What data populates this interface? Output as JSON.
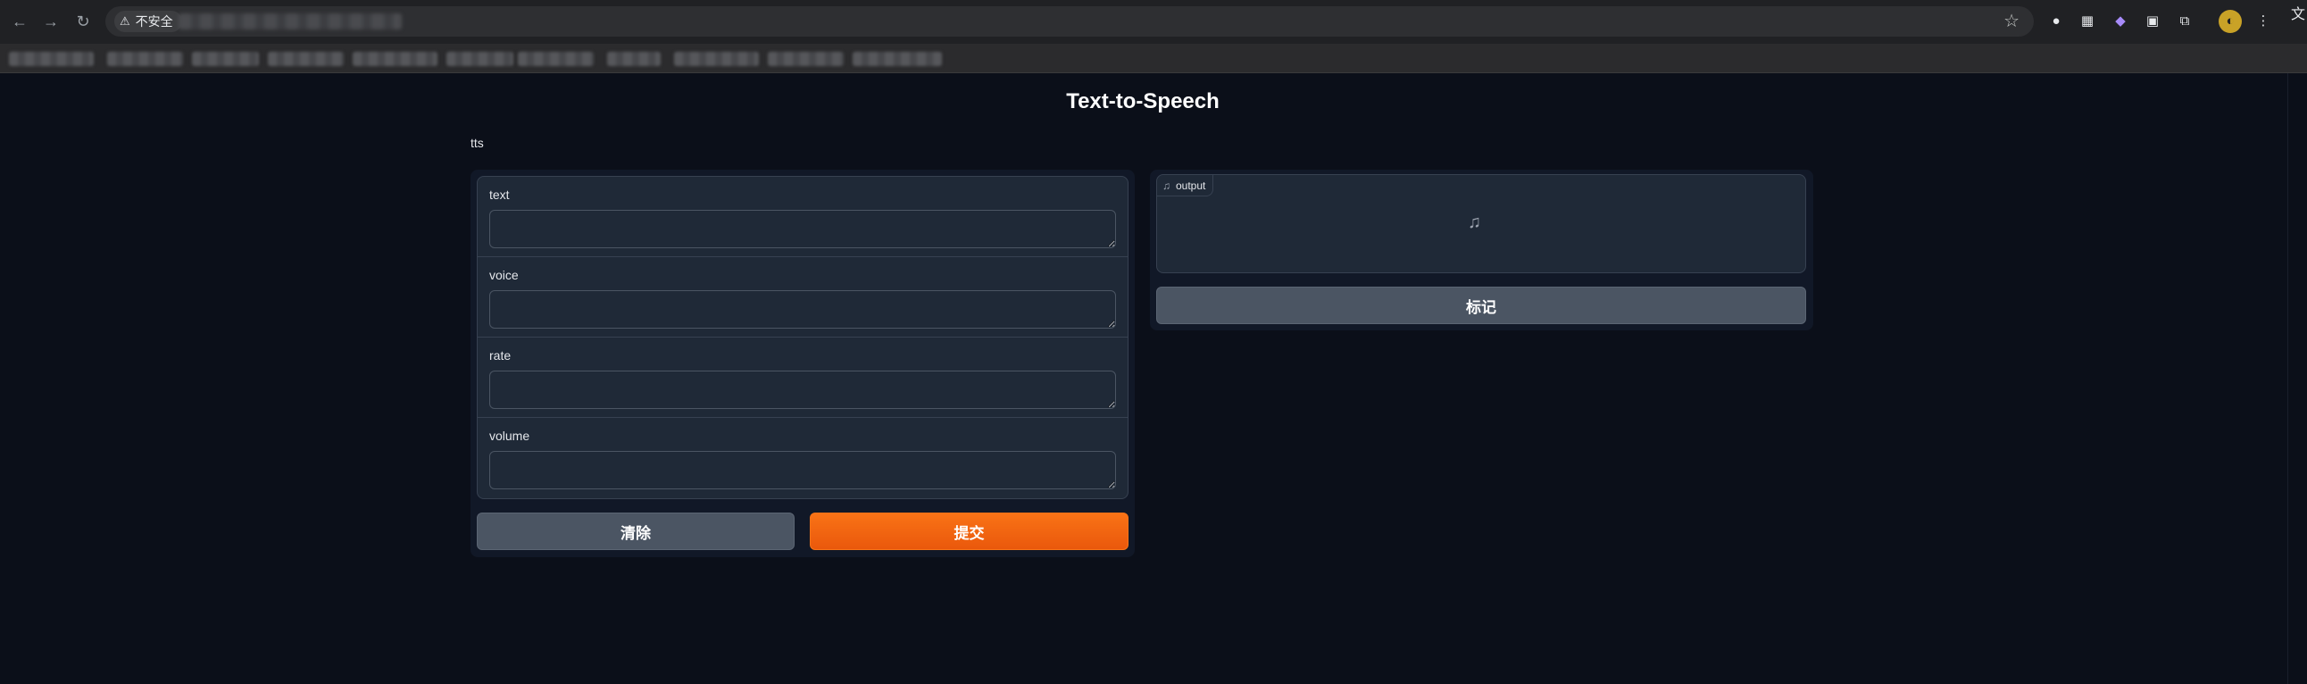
{
  "browser": {
    "security_label": "不安全",
    "nav": {
      "back": "←",
      "forward": "→",
      "reload": "↻"
    },
    "bookmark_icon": "star-icon",
    "corner_text": "文"
  },
  "app": {
    "title": "Text-to-Speech",
    "description": "tts"
  },
  "inputs": [
    {
      "label": "text",
      "value": ""
    },
    {
      "label": "voice",
      "value": ""
    },
    {
      "label": "rate",
      "value": ""
    },
    {
      "label": "volume",
      "value": ""
    }
  ],
  "buttons": {
    "clear": "清除",
    "submit": "提交",
    "flag": "标记"
  },
  "output": {
    "label": "output",
    "icon": "music-note-icon"
  },
  "colors": {
    "background": "#0b0f19",
    "panel": "#111827",
    "block": "#1f2937",
    "primary": "#f97316",
    "secondary": "#4b5563"
  }
}
